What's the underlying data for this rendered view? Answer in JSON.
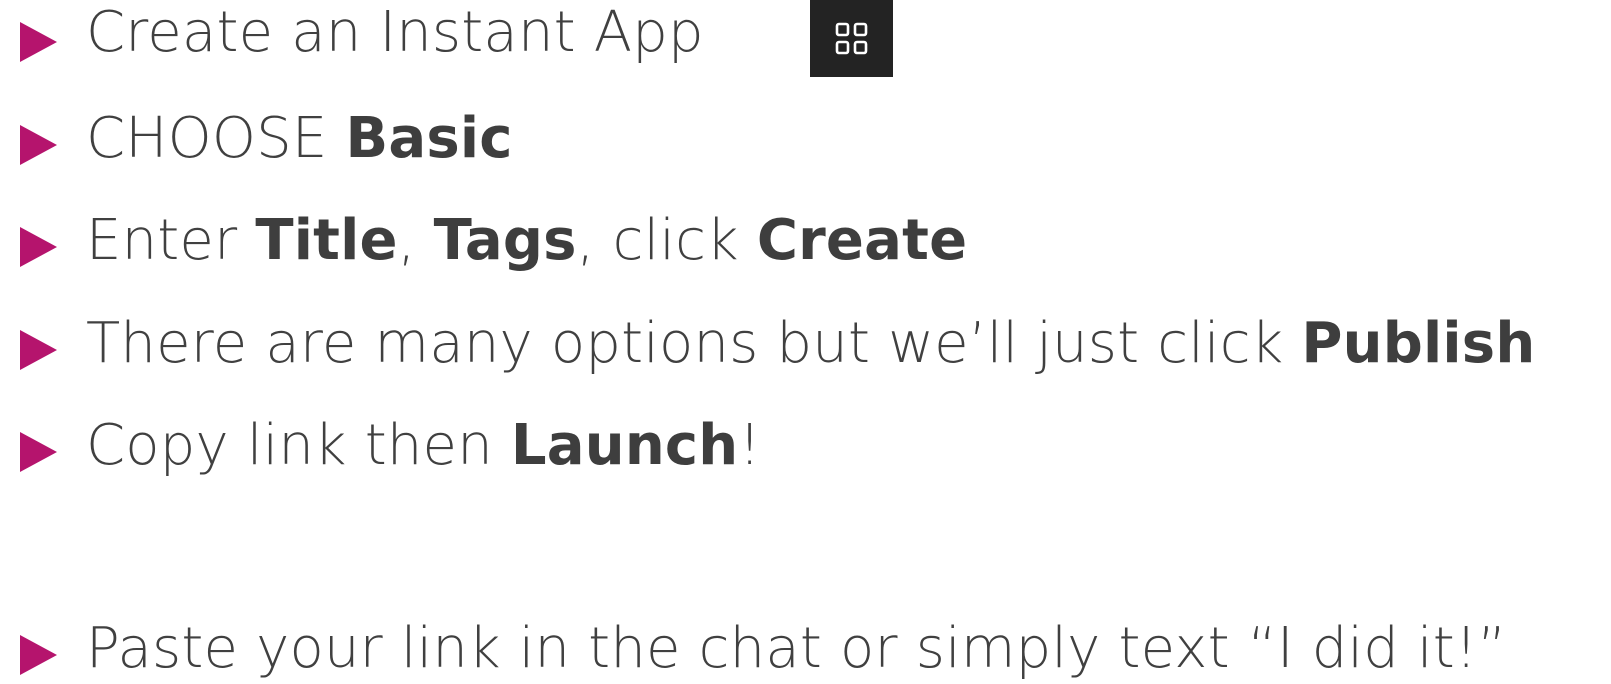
{
  "bullets": [
    {
      "parts": [
        {
          "text": "Create an Instant App",
          "bold": false
        }
      ],
      "icon": "apps-grid-icon"
    },
    {
      "parts": [
        {
          "text": "CHOOSE ",
          "bold": false
        },
        {
          "text": "Basic",
          "bold": true
        }
      ]
    },
    {
      "parts": [
        {
          "text": "Enter ",
          "bold": false
        },
        {
          "text": "Title",
          "bold": true
        },
        {
          "text": ", ",
          "bold": false
        },
        {
          "text": "Tags",
          "bold": true
        },
        {
          "text": ", click ",
          "bold": false
        },
        {
          "text": "Create",
          "bold": true
        }
      ]
    },
    {
      "parts": [
        {
          "text": "There are many options but we’ll just click ",
          "bold": false
        },
        {
          "text": "Publish",
          "bold": true
        }
      ]
    },
    {
      "parts": [
        {
          "text": "Copy link then ",
          "bold": false
        },
        {
          "text": "Launch",
          "bold": true
        },
        {
          "text": "!",
          "bold": false
        }
      ]
    },
    {
      "parts": [
        {
          "text": "Paste your link in the chat or simply text “I did it!”",
          "bold": false
        }
      ]
    }
  ],
  "colors": {
    "bullet_arrow": "#b5146d",
    "text": "#404040",
    "icon_tile": "#232323",
    "icon_glyph": "#ffffff"
  }
}
